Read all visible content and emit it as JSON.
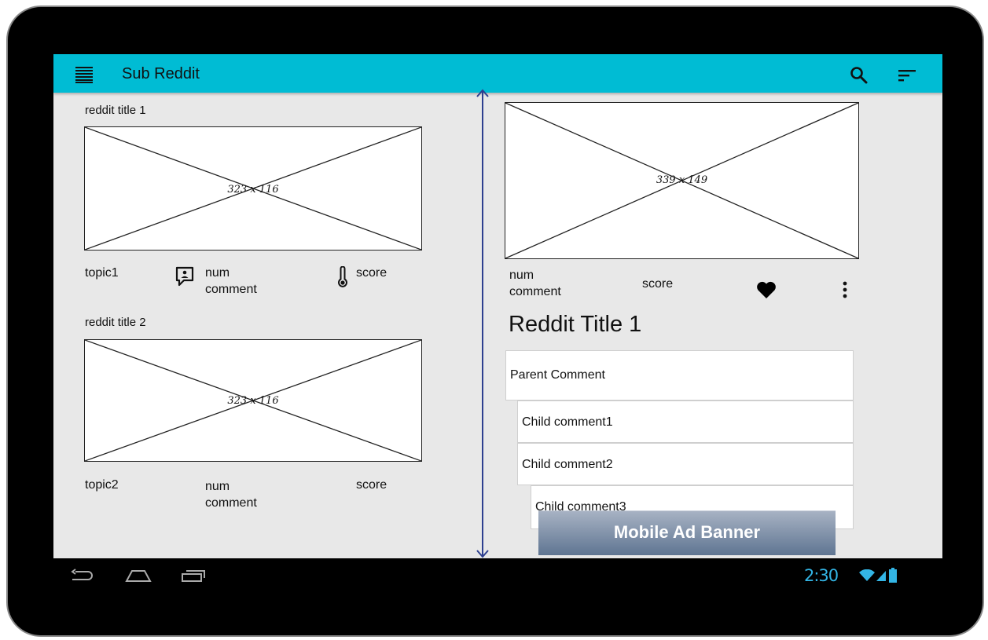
{
  "app": {
    "title": "Sub Reddit"
  },
  "appbar": {
    "menu_icon": "menu-icon",
    "search_icon": "search-icon",
    "sort_icon": "sort-icon",
    "color": "#00bcd4"
  },
  "feed": {
    "items": [
      {
        "title": "reddit title 1",
        "image_label": "323 x 116",
        "topic": "topic1",
        "num_comment": [
          "num",
          "comment"
        ],
        "score": "score",
        "comment_icon": "comment-icon",
        "score_icon": "thermometer-icon"
      },
      {
        "title": "reddit title 2",
        "image_label": "323 x 116",
        "topic": "topic2",
        "num_comment": [
          "num",
          "comment"
        ],
        "score": "score"
      }
    ]
  },
  "detail": {
    "image_label": "339 x 149",
    "num_comment": [
      "num",
      "comment"
    ],
    "score": "score",
    "like_icon": "heart-icon",
    "more_icon": "more-vert-icon",
    "title": "Reddit Title 1",
    "comments": [
      {
        "text": "Parent Comment",
        "level": 0
      },
      {
        "text": "Child comment1",
        "level": 1
      },
      {
        "text": "Child comment2",
        "level": 1
      },
      {
        "text": "Child comment3",
        "level": 2
      }
    ]
  },
  "ad": {
    "label": "Mobile Ad Banner"
  },
  "system_bar": {
    "time": "2:30",
    "clock_color": "#33b5e5",
    "nav_icons": [
      "back-icon",
      "home-icon",
      "recents-icon"
    ],
    "status_icons": [
      "wifi-icon",
      "signal-icon",
      "battery-icon"
    ]
  }
}
